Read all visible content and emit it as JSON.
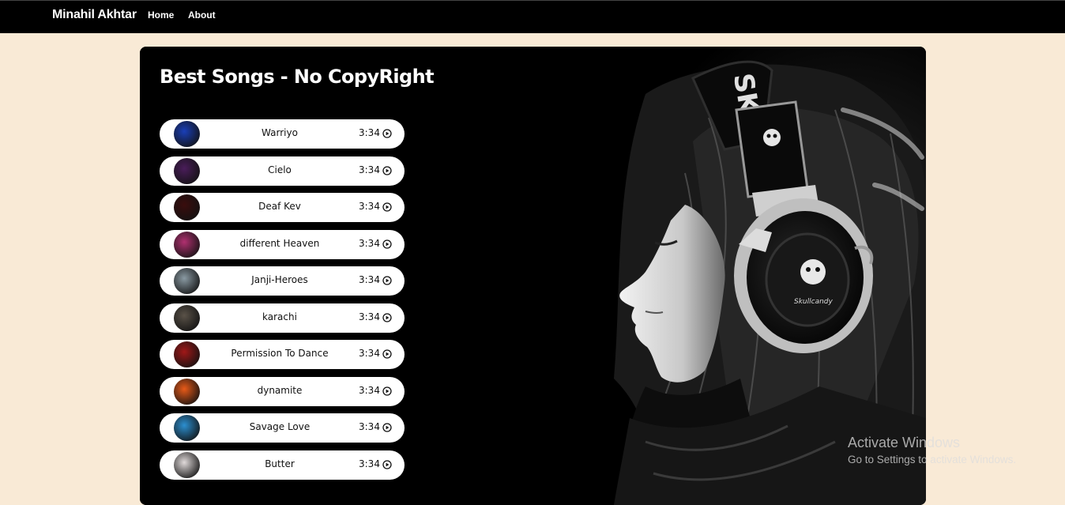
{
  "nav": {
    "brand": "Minahil Akhtar",
    "links": [
      {
        "label": "Home"
      },
      {
        "label": "About"
      }
    ]
  },
  "main": {
    "title": "Best Songs - No CopyRight",
    "songs": [
      {
        "name": "Warriyo",
        "duration": "3:34",
        "cover_color": "#1a3fb8"
      },
      {
        "name": "Cielo",
        "duration": "3:34",
        "cover_color": "#4a1d5a"
      },
      {
        "name": "Deaf Kev",
        "duration": "3:34",
        "cover_color": "#3a0d0d"
      },
      {
        "name": "different Heaven",
        "duration": "3:34",
        "cover_color": "#b03070"
      },
      {
        "name": "Janji-Heroes",
        "duration": "3:34",
        "cover_color": "#8a9aa3"
      },
      {
        "name": "karachi",
        "duration": "3:34",
        "cover_color": "#5a5248"
      },
      {
        "name": "Permission To Dance",
        "duration": "3:34",
        "cover_color": "#a01818"
      },
      {
        "name": "dynamite",
        "duration": "3:34",
        "cover_color": "#e85a18"
      },
      {
        "name": "Savage Love",
        "duration": "3:34",
        "cover_color": "#2c8fd0"
      },
      {
        "name": "Butter",
        "duration": "3:34",
        "cover_color": "#e0dada"
      }
    ]
  },
  "overlay": {
    "activate_title": "Activate Windows",
    "activate_sub": "Go to Settings to activate Windows."
  }
}
